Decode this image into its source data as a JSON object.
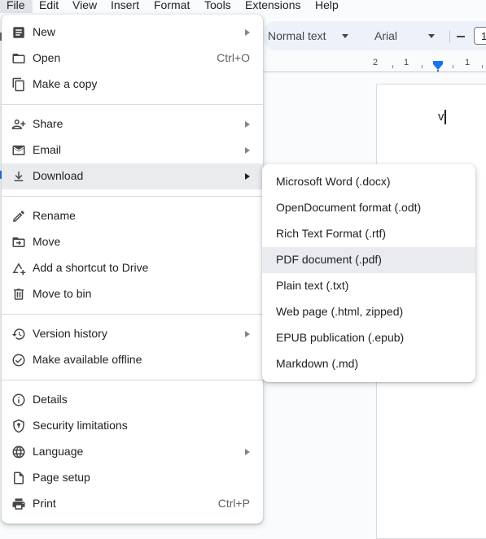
{
  "menubar": {
    "items": [
      "File",
      "Edit",
      "View",
      "Insert",
      "Format",
      "Tools",
      "Extensions",
      "Help"
    ]
  },
  "toolbar": {
    "style_select": "Normal text",
    "font_select": "Arial",
    "font_size": "1"
  },
  "ruler": {
    "labels": [
      "2",
      "1",
      "1"
    ]
  },
  "document": {
    "text": "v"
  },
  "file_menu": {
    "items": [
      {
        "label": "New",
        "icon": "new-document-icon",
        "submenu": true
      },
      {
        "label": "Open",
        "icon": "folder-icon",
        "shortcut": "Ctrl+O"
      },
      {
        "label": "Make a copy",
        "icon": "copy-icon"
      },
      {
        "label": "Share",
        "icon": "person-add-icon",
        "submenu": true
      },
      {
        "label": "Email",
        "icon": "mail-icon",
        "submenu": true
      },
      {
        "label": "Download",
        "icon": "download-icon",
        "submenu": true
      },
      {
        "label": "Rename",
        "icon": "pencil-icon"
      },
      {
        "label": "Move",
        "icon": "move-folder-icon"
      },
      {
        "label": "Add a shortcut to Drive",
        "icon": "drive-shortcut-icon"
      },
      {
        "label": "Move to bin",
        "icon": "trash-icon"
      },
      {
        "label": "Version history",
        "icon": "history-icon",
        "submenu": true
      },
      {
        "label": "Make available offline",
        "icon": "offline-check-icon"
      },
      {
        "label": "Details",
        "icon": "info-icon"
      },
      {
        "label": "Security limitations",
        "icon": "shield-icon"
      },
      {
        "label": "Language",
        "icon": "globe-icon",
        "submenu": true
      },
      {
        "label": "Page setup",
        "icon": "page-setup-icon"
      },
      {
        "label": "Print",
        "icon": "printer-icon",
        "shortcut": "Ctrl+P"
      }
    ]
  },
  "download_submenu": {
    "items": [
      "Microsoft Word (.docx)",
      "OpenDocument format (.odt)",
      "Rich Text Format (.rtf)",
      "PDF document (.pdf)",
      "Plain text (.txt)",
      "Web page (.html, zipped)",
      "EPUB publication (.epub)",
      "Markdown (.md)"
    ]
  },
  "colors": {
    "accent": "#1a73e8",
    "highlight": "#e9ebef",
    "menu_bg": "#ffffff"
  }
}
